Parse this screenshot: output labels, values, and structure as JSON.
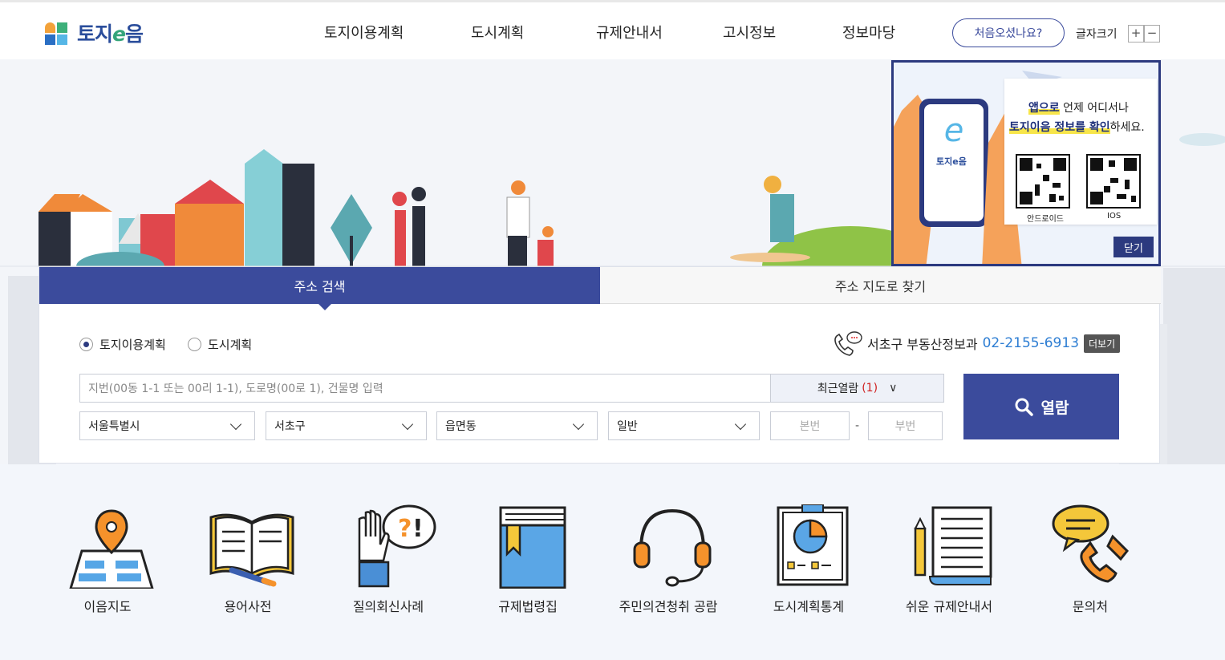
{
  "brand": {
    "name_part1": "토지",
    "name_e": "e",
    "name_part2": "음"
  },
  "nav": [
    "토지이용계획",
    "도시계획",
    "규제안내서",
    "고시정보",
    "정보마당"
  ],
  "header": {
    "first_visit": "처음오셨나요?",
    "font_size_label": "글자크기",
    "plus": "+",
    "minus": "−"
  },
  "popup": {
    "line1_hl": "앱으로",
    "line1_rest": " 언제 어디서나",
    "line2_hl": "토지이음 정보를 확인",
    "line2_rest": "하세요.",
    "app_logo": "토지e음",
    "qr_android": "안드로이드",
    "qr_ios": "IOS",
    "close": "닫기"
  },
  "search": {
    "tab_active": "주소 검색",
    "tab_inactive": "주소 지도로 찾기",
    "radio_1": "토지이용계획",
    "radio_2": "도시계획",
    "contact_label": "서초구 부동산정보과",
    "contact_phone": "02-2155-6913",
    "more": "더보기",
    "address_placeholder": "지번(00동 1-1 또는 00리 1-1), 도로명(00로 1), 건물명 입력",
    "recent_label": "최근열람",
    "recent_count": "(1)",
    "sido": "서울특별시",
    "sigungu": "서초구",
    "eupmyeondong": "읍면동",
    "type": "일반",
    "main_no": "본번",
    "sub_no": "부번",
    "dash": "-",
    "search_button": "열람"
  },
  "quick_menu": [
    {
      "label": "이음지도",
      "icon": "map-pin-icon"
    },
    {
      "label": "용어사전",
      "icon": "open-book-icon"
    },
    {
      "label": "질의회신사례",
      "icon": "question-hand-icon"
    },
    {
      "label": "규제법령집",
      "icon": "law-book-icon"
    },
    {
      "label": "주민의견청취 공람",
      "icon": "headset-icon"
    },
    {
      "label": "도시계획통계",
      "icon": "pie-board-icon"
    },
    {
      "label": "쉬운 규제안내서",
      "icon": "document-pencil-icon"
    },
    {
      "label": "문의처",
      "icon": "phone-chat-icon"
    }
  ]
}
